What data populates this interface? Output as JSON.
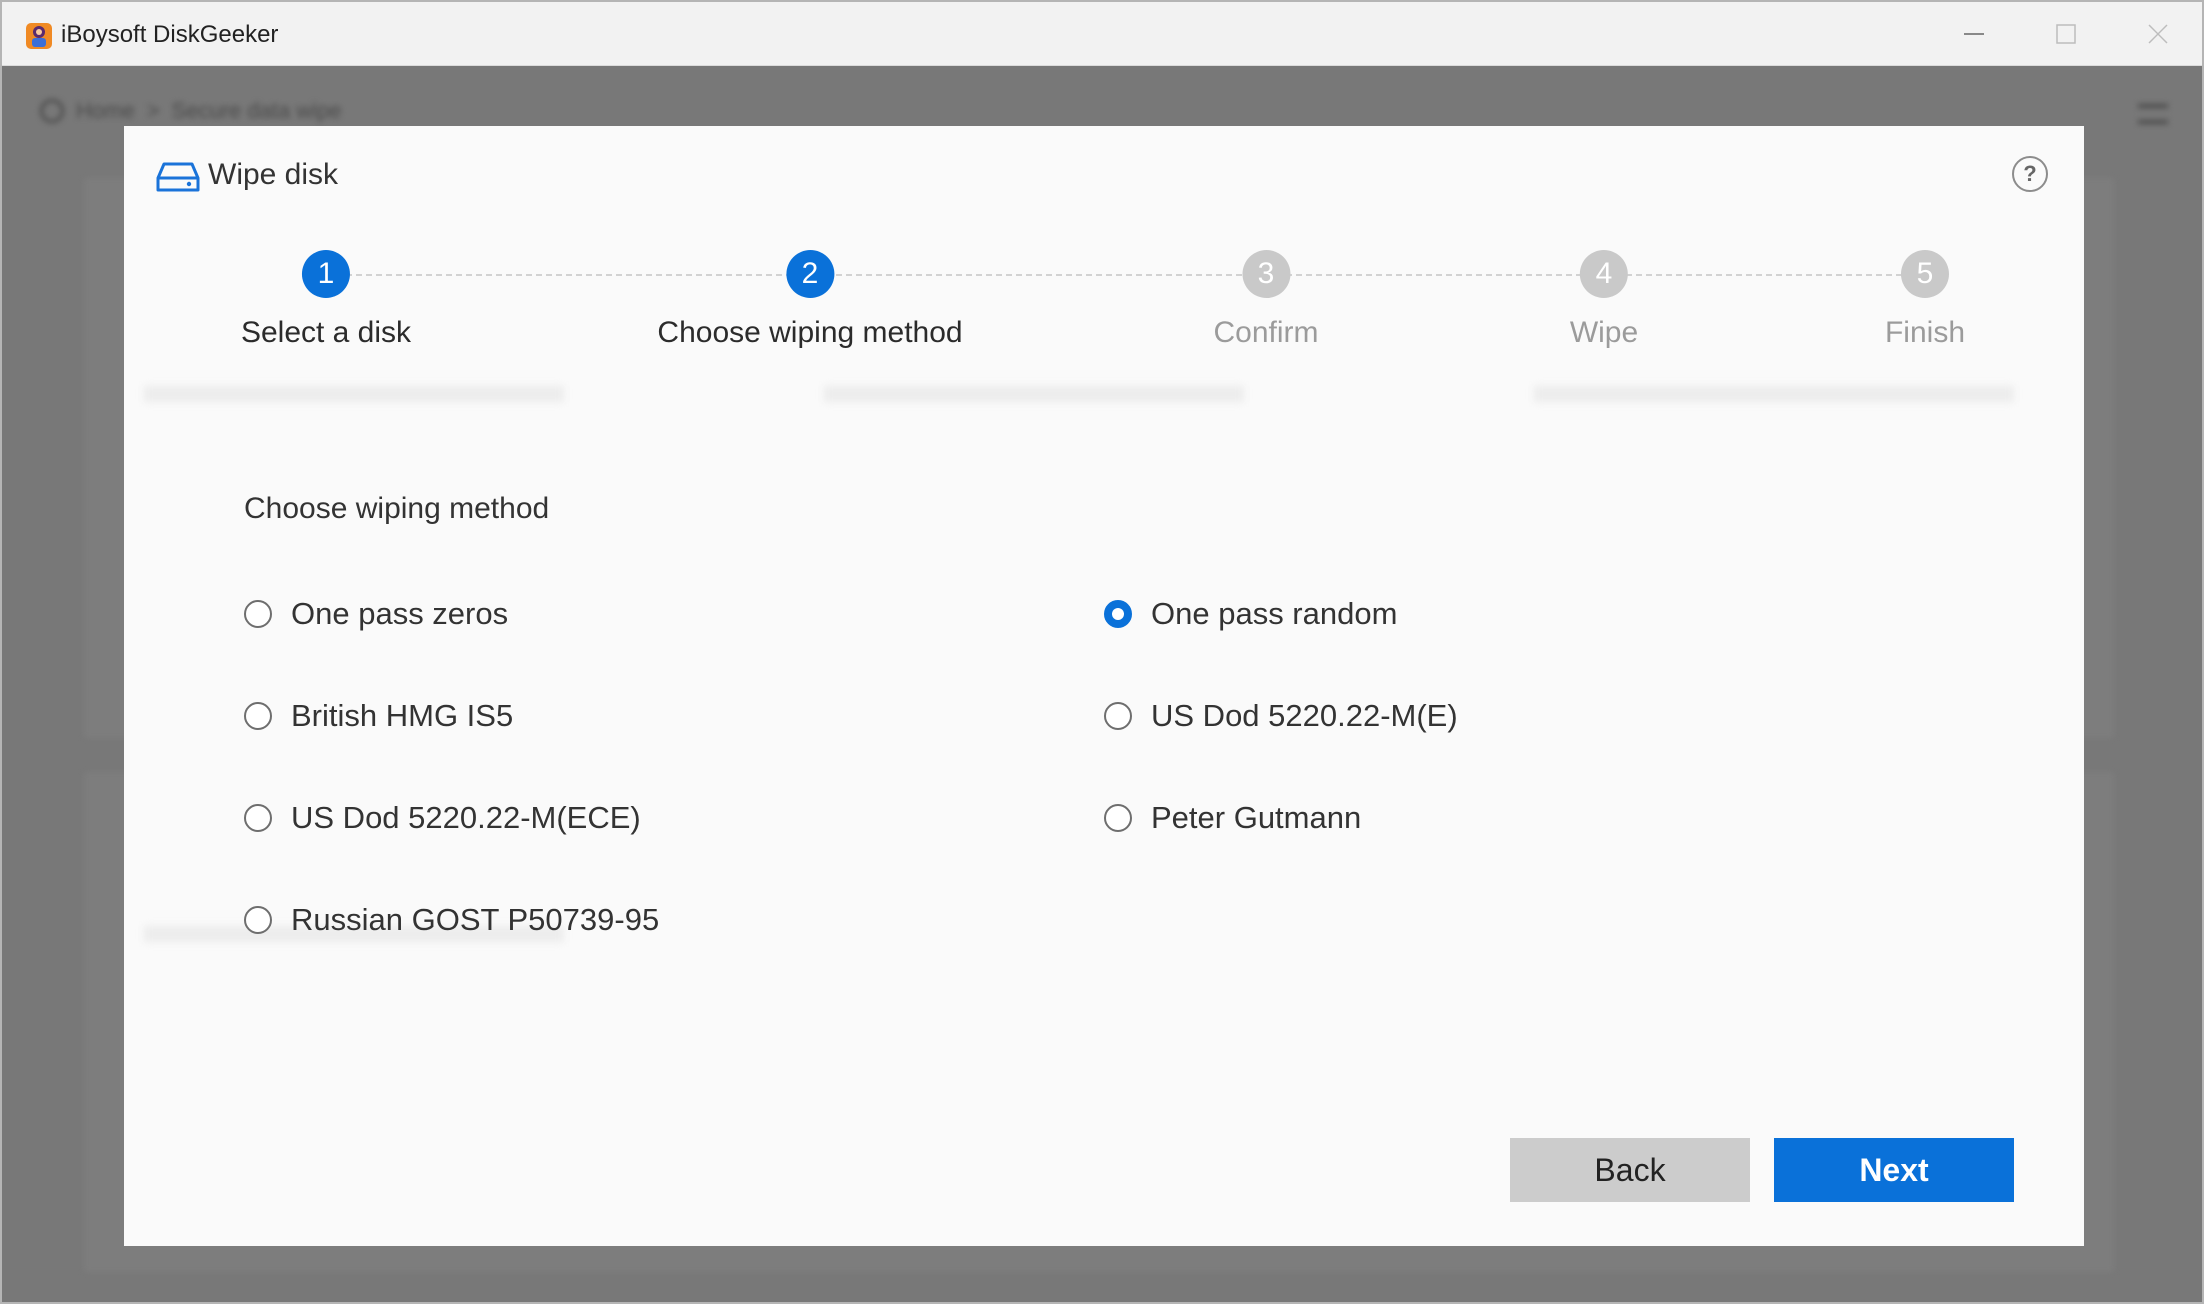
{
  "app": {
    "title": "iBoysoft DiskGeeker",
    "icon": "app-logo-icon"
  },
  "window_controls": [
    "minimize-icon",
    "maximize-icon",
    "close-icon"
  ],
  "background": {
    "breadcrumb": [
      "Home",
      ">",
      "Secure data wipe"
    ]
  },
  "dialog": {
    "title": "Wipe disk",
    "title_icon": "disk-drive-icon",
    "help_label": "?",
    "steps": [
      {
        "number": "1",
        "label": "Select a disk",
        "state": "active"
      },
      {
        "number": "2",
        "label": "Choose wiping method",
        "state": "active"
      },
      {
        "number": "3",
        "label": "Confirm",
        "state": "inactive"
      },
      {
        "number": "4",
        "label": "Wipe",
        "state": "inactive"
      },
      {
        "number": "5",
        "label": "Finish",
        "state": "inactive"
      }
    ],
    "section_title": "Choose wiping method",
    "methods": [
      {
        "label": "One pass zeros",
        "checked": false
      },
      {
        "label": "One pass random",
        "checked": true
      },
      {
        "label": "British HMG IS5",
        "checked": false
      },
      {
        "label": "US Dod 5220.22-M(E)",
        "checked": false
      },
      {
        "label": "US Dod 5220.22-M(ECE)",
        "checked": false
      },
      {
        "label": "Peter Gutmann",
        "checked": false
      },
      {
        "label": "Russian GOST P50739-95",
        "checked": false
      }
    ],
    "selected_method": "One pass random",
    "back_label": "Back",
    "next_label": "Next"
  },
  "colors": {
    "accent": "#0a71d9",
    "inactive_step": "#c9c9c9",
    "back_button": "#cccccc",
    "overlay": "#787878"
  }
}
